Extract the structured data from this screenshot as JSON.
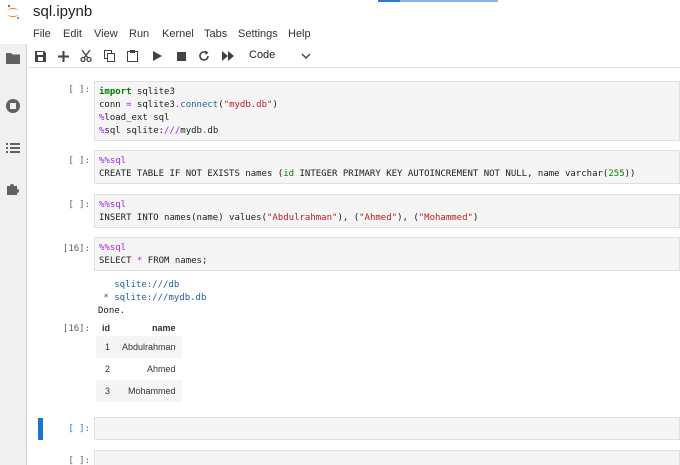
{
  "window": {
    "title": "sql.ipynb"
  },
  "menu": [
    "File",
    "Edit",
    "View",
    "Run",
    "Kernel",
    "Tabs",
    "Settings",
    "Help"
  ],
  "toolbar": {
    "cell_type": "Code"
  },
  "cells": [
    {
      "prompt": "[ ]:",
      "lines": [
        "import sqlite3",
        "conn = sqlite3.connect(\"mydb.db\")",
        "%load_ext sql",
        "%sql sqlite:///mydb.db"
      ]
    },
    {
      "prompt": "[ ]:",
      "lines": [
        "%%sql",
        "CREATE TABLE IF NOT EXISTS names (id INTEGER PRIMARY KEY AUTOINCREMENT NOT NULL, name varchar(255))"
      ]
    },
    {
      "prompt": "[ ]:",
      "lines": [
        "%%sql",
        "INSERT INTO names(name) values(\"Abdulrahman\"), (\"Ahmed\"), (\"Mohammed\")"
      ]
    },
    {
      "prompt": "[16]:",
      "lines": [
        "%%sql",
        "SELECT * FROM names;"
      ]
    },
    {
      "prompt": "[ ]:",
      "lines": []
    },
    {
      "prompt": "[ ]:",
      "lines": []
    }
  ],
  "output_stdout": {
    "line1": "   sqlite:///db",
    "line2": " * sqlite:///mydb.db",
    "line3": "Done."
  },
  "output_prompt": "[16]:",
  "result_table": {
    "headers": [
      "id",
      "name"
    ],
    "rows": [
      [
        "1",
        "Abdulrahman"
      ],
      [
        "2",
        "Ahmed"
      ],
      [
        "3",
        "Mohammed"
      ]
    ]
  }
}
